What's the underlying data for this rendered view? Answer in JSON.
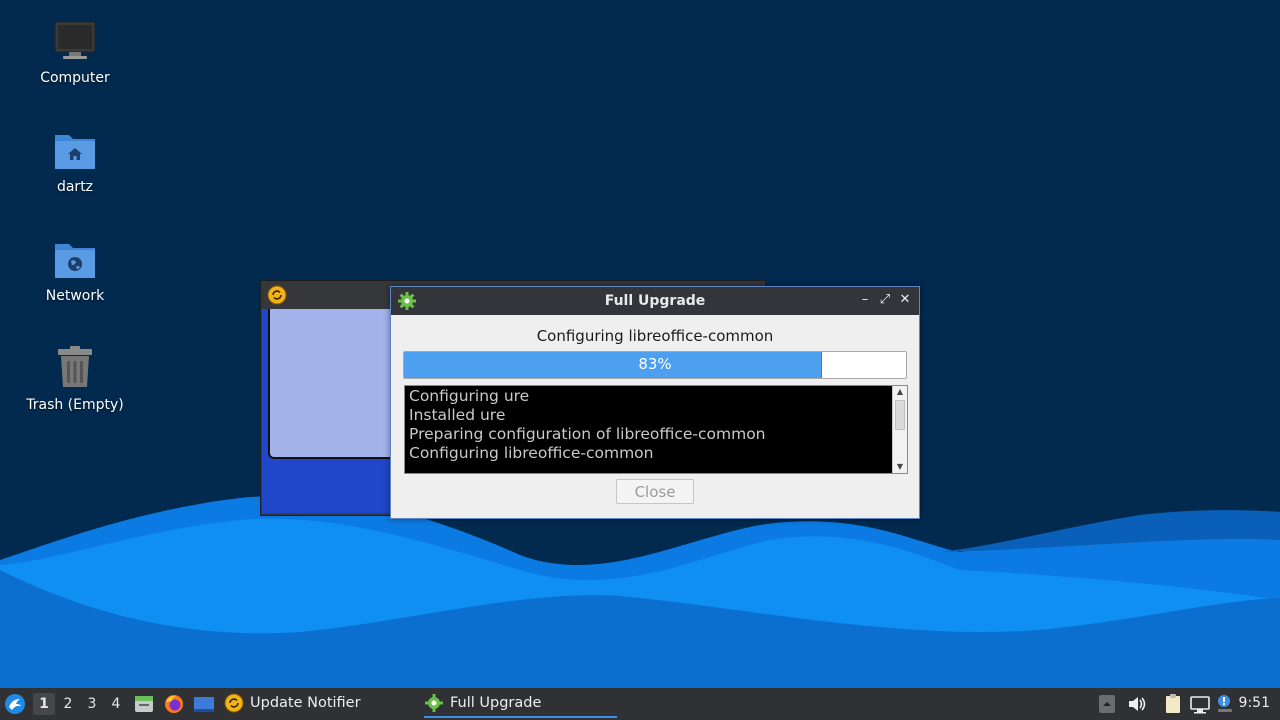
{
  "desktop": {
    "icons": [
      {
        "label": "Computer",
        "icon": "monitor-icon"
      },
      {
        "label": "dartz",
        "icon": "home-folder-icon"
      },
      {
        "label": "Network",
        "icon": "network-folder-icon"
      },
      {
        "label": "Trash (Empty)",
        "icon": "trash-icon"
      }
    ]
  },
  "upgrade_dialog": {
    "title": "Full Upgrade",
    "status": "Configuring libreoffice-common",
    "progress_percent": 83,
    "progress_label": "83%",
    "log_lines": [
      "Configuring ure",
      "Installed ure",
      "Preparing configuration of libreoffice-common",
      "Configuring libreoffice-common"
    ],
    "close_label": "Close",
    "minimize_glyph": "–",
    "maximize_glyph": "⤢",
    "close_glyph": "✕"
  },
  "taskbar": {
    "workspaces": [
      "1",
      "2",
      "3",
      "4"
    ],
    "active_workspace": "1",
    "tasks": [
      {
        "label": "Update Notifier",
        "icon": "update-notifier-icon"
      },
      {
        "label": "Full Upgrade",
        "icon": "gear-icon"
      }
    ],
    "clock": "9:51"
  },
  "colors": {
    "desktop_bg": "#022a4f",
    "wave_light": "#0e8ff1",
    "wave_dark": "#0b6fd0",
    "progress_fill": "#4d9ff0",
    "accent": "#3d8ee6"
  }
}
